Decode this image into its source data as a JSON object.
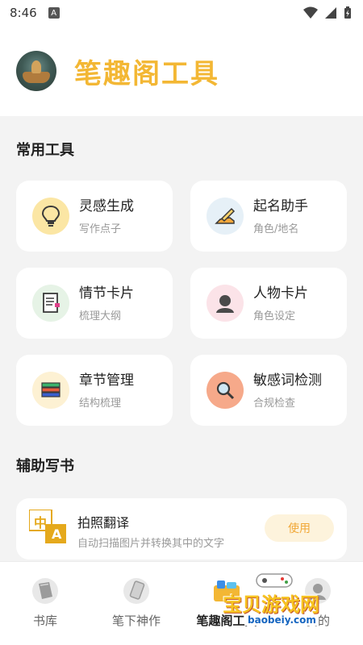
{
  "status_bar": {
    "time": "8:46",
    "notif_badge": "A"
  },
  "header": {
    "title": "笔趣阁工具"
  },
  "sections": {
    "common_title": "常用工具",
    "assist_title": "辅助写书"
  },
  "tools": [
    {
      "title": "灵感生成",
      "subtitle": "写作点子",
      "icon": "lightbulb-icon",
      "bg": "#fbe6a4"
    },
    {
      "title": "起名助手",
      "subtitle": "角色/地名",
      "icon": "pen-icon",
      "bg": "#e6f0f7"
    },
    {
      "title": "情节卡片",
      "subtitle": "梳理大纲",
      "icon": "document-icon",
      "bg": "#e6f3e6"
    },
    {
      "title": "人物卡片",
      "subtitle": "角色设定",
      "icon": "person-icon",
      "bg": "#fbe3e8"
    },
    {
      "title": "章节管理",
      "subtitle": "结构梳理",
      "icon": "books-icon",
      "bg": "#fdf1d3"
    },
    {
      "title": "敏感词检测",
      "subtitle": "合规检查",
      "icon": "magnifier-icon",
      "bg": "#f6a98a"
    }
  ],
  "translate": {
    "title": "拍照翻译",
    "subtitle": "自动扫描图片并转换其中的文字",
    "button": "使用",
    "icon_char_top": "中",
    "icon_char_bottom": "A"
  },
  "tabs": [
    {
      "label": "书库",
      "icon": "book-icon",
      "active": false
    },
    {
      "label": "笔下神作",
      "icon": "pencil-icon",
      "active": false
    },
    {
      "label": "笔趣阁工具",
      "icon": "toolbox-icon",
      "active": true
    },
    {
      "label": "我的",
      "icon": "profile-icon",
      "active": false
    }
  ],
  "watermark": {
    "text": "宝贝游戏网",
    "url": "baobeiy.com"
  },
  "colors": {
    "accent": "#f3b734",
    "background": "#f3f3f3",
    "button_bg": "#fdf3dc"
  }
}
